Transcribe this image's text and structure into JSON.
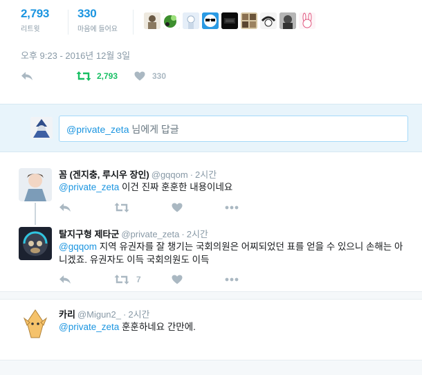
{
  "stats": {
    "retweets": {
      "count": "2,793",
      "label": "리트윗"
    },
    "likes": {
      "count": "330",
      "label": "마음에 들어요"
    }
  },
  "likers": [
    "liker-1",
    "liker-2",
    "liker-3",
    "liker-4",
    "liker-5",
    "liker-6",
    "liker-7",
    "liker-8",
    "liker-9"
  ],
  "main_tweet": {
    "timestamp": "오후 9:23 - 2016년 12월 3일",
    "retweet_count": "2,793",
    "like_count": "330"
  },
  "reply_box": {
    "mention": "@private_zeta",
    "suffix": " 님에게 답글"
  },
  "replies": [
    {
      "name": "꼼 (겐지충, 루시우 장인)",
      "handle": "@gqqom",
      "time": "2시간",
      "mention": "@private_zeta",
      "text": " 이건 진짜 훈훈한 내용이네요",
      "retweet_count": "",
      "like_count": ""
    },
    {
      "name": "탈지구형 제타군",
      "handle": "@private_zeta",
      "time": "2시간",
      "mention": "@gqqom",
      "text": " 지역 유권자를 잘 챙기는 국회의원은 어찌되었던 표를 얻을 수 있으니 손해는 아니겠죠. 유권자도 이득 국회의원도 이득",
      "retweet_count": "7",
      "like_count": ""
    },
    {
      "name": "카리",
      "handle": "@Migun2_",
      "time": "2시간",
      "mention": "@private_zeta",
      "text": " 훈훈하네요 간만에.",
      "retweet_count": "",
      "like_count": ""
    }
  ],
  "colors": {
    "accent": "#1b95e0",
    "retweet_active": "#17bf63",
    "muted": "#aab8c2"
  }
}
